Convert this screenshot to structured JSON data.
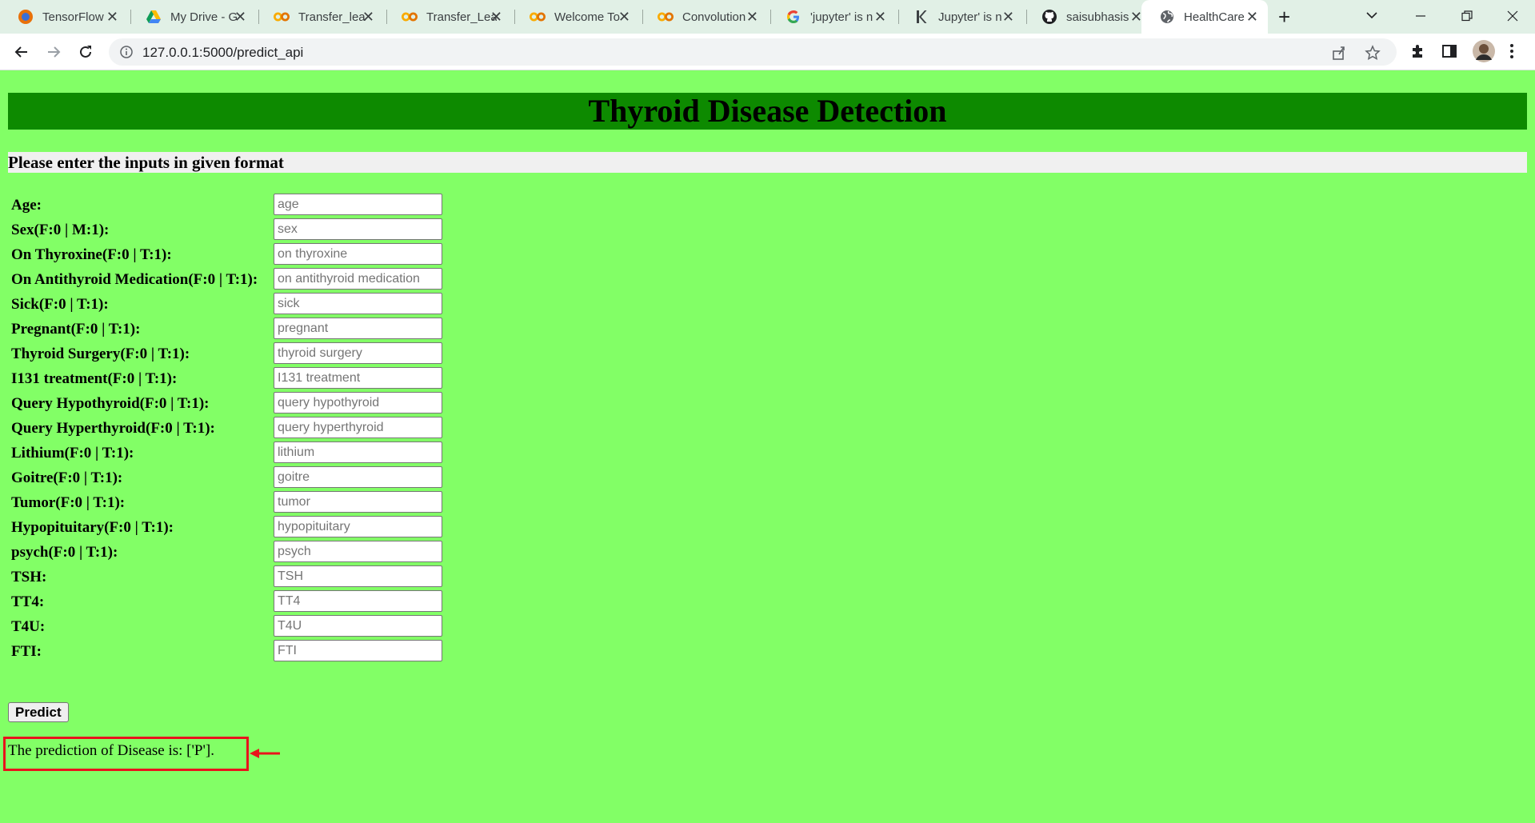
{
  "browser": {
    "tabs": [
      {
        "title": "TensorFlow",
        "favicon": "tensorflow-icon"
      },
      {
        "title": "My Drive - G",
        "favicon": "google-drive-icon"
      },
      {
        "title": "Transfer_lea",
        "favicon": "colab-icon"
      },
      {
        "title": "Transfer_Lea",
        "favicon": "colab-icon"
      },
      {
        "title": "Welcome To",
        "favicon": "colab-icon"
      },
      {
        "title": "Convolution",
        "favicon": "colab-icon"
      },
      {
        "title": "'jupyter' is n",
        "favicon": "google-icon"
      },
      {
        "title": "Jupyter' is n",
        "favicon": "kaggle-icon"
      },
      {
        "title": "saisubhasis",
        "favicon": "github-icon"
      },
      {
        "title": "HealthCare",
        "favicon": "globe-icon",
        "active": true
      }
    ],
    "url": "127.0.0.1:5000/predict_api"
  },
  "page": {
    "title": "Thyroid Disease Detection",
    "subtitle": "Please enter the inputs in given format",
    "fields": [
      {
        "label": "Age:",
        "placeholder": "age"
      },
      {
        "label": "Sex(F:0 | M:1):",
        "placeholder": "sex"
      },
      {
        "label": "On Thyroxine(F:0 | T:1):",
        "placeholder": "on thyroxine"
      },
      {
        "label": "On Antithyroid Medication(F:0 | T:1):",
        "placeholder": "on antithyroid medication"
      },
      {
        "label": "Sick(F:0 | T:1):",
        "placeholder": "sick"
      },
      {
        "label": "Pregnant(F:0 | T:1):",
        "placeholder": "pregnant"
      },
      {
        "label": "Thyroid Surgery(F:0 | T:1):",
        "placeholder": "thyroid surgery"
      },
      {
        "label": "I131 treatment(F:0 | T:1):",
        "placeholder": "I131 treatment"
      },
      {
        "label": "Query Hypothyroid(F:0 | T:1):",
        "placeholder": "query hypothyroid"
      },
      {
        "label": "Query Hyperthyroid(F:0 | T:1):",
        "placeholder": "query hyperthyroid"
      },
      {
        "label": "Lithium(F:0 | T:1):",
        "placeholder": "lithium"
      },
      {
        "label": "Goitre(F:0 | T:1):",
        "placeholder": "goitre"
      },
      {
        "label": "Tumor(F:0 | T:1):",
        "placeholder": "tumor"
      },
      {
        "label": "Hypopituitary(F:0 | T:1):",
        "placeholder": "hypopituitary"
      },
      {
        "label": "psych(F:0 | T:1):",
        "placeholder": "psych"
      },
      {
        "label": "TSH:",
        "placeholder": "TSH"
      },
      {
        "label": "TT4:",
        "placeholder": "TT4"
      },
      {
        "label": "T4U:",
        "placeholder": "T4U"
      },
      {
        "label": "FTI:",
        "placeholder": "FTI"
      }
    ],
    "predict_label": "Predict",
    "result_text": "The prediction of Disease is: ['P']."
  },
  "colors": {
    "page_background": "#82ff66",
    "banner": "#0d8a00",
    "highlight_box": "#e8141c"
  }
}
